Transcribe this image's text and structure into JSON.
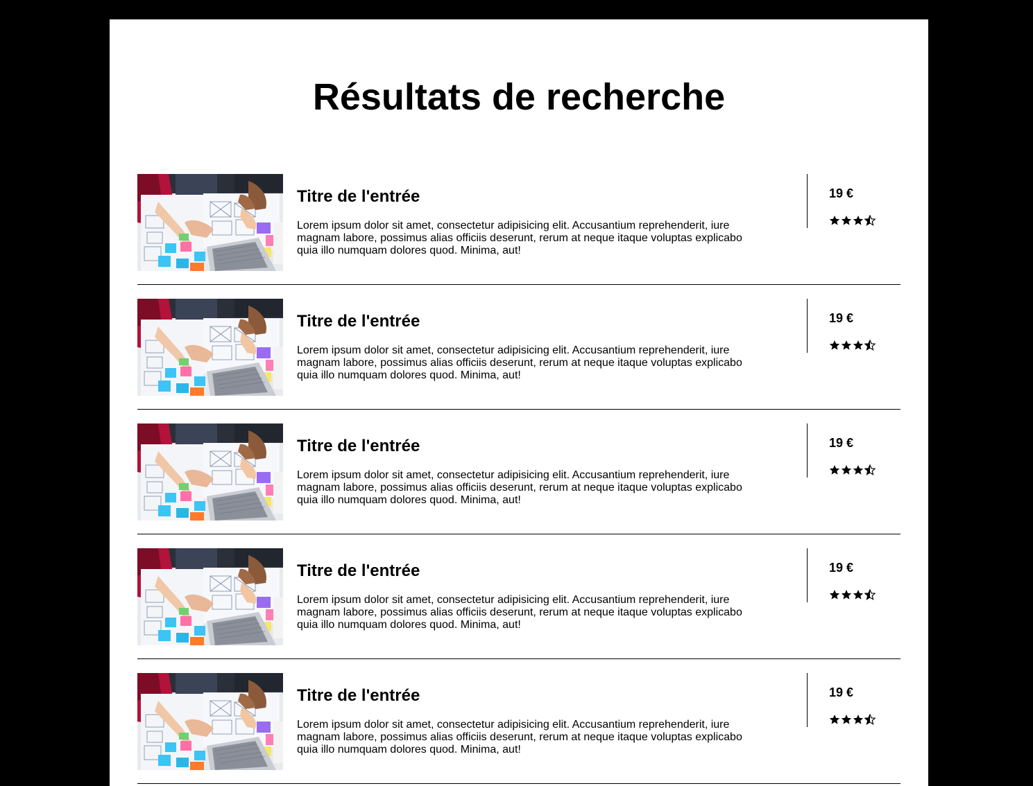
{
  "page": {
    "title": "Résultats de recherche"
  },
  "colors": {
    "background": "#000000",
    "panel": "#ffffff",
    "text": "#000000"
  },
  "results": [
    {
      "image_icon": "team-working-photo",
      "title": "Titre de l'entrée",
      "description": "Lorem ipsum dolor sit amet, consectetur adipisicing elit. Accusantium reprehenderit, iure magnam labore, possimus alias officiis deserunt, rerum at neque itaque voluptas explicabo quia illo numquam dolores quod. Minima, aut!",
      "price": "19 €",
      "rating": 3.5,
      "rating_max": 5
    },
    {
      "image_icon": "team-working-photo",
      "title": "Titre de l'entrée",
      "description": "Lorem ipsum dolor sit amet, consectetur adipisicing elit. Accusantium reprehenderit, iure magnam labore, possimus alias officiis deserunt, rerum at neque itaque voluptas explicabo quia illo numquam dolores quod. Minima, aut!",
      "price": "19 €",
      "rating": 3.5,
      "rating_max": 5
    },
    {
      "image_icon": "team-working-photo",
      "title": "Titre de l'entrée",
      "description": "Lorem ipsum dolor sit amet, consectetur adipisicing elit. Accusantium reprehenderit, iure magnam labore, possimus alias officiis deserunt, rerum at neque itaque voluptas explicabo quia illo numquam dolores quod. Minima, aut!",
      "price": "19 €",
      "rating": 3.5,
      "rating_max": 5
    },
    {
      "image_icon": "team-working-photo",
      "title": "Titre de l'entrée",
      "description": "Lorem ipsum dolor sit amet, consectetur adipisicing elit. Accusantium reprehenderit, iure magnam labore, possimus alias officiis deserunt, rerum at neque itaque voluptas explicabo quia illo numquam dolores quod. Minima, aut!",
      "price": "19 €",
      "rating": 3.5,
      "rating_max": 5
    },
    {
      "image_icon": "team-working-photo",
      "title": "Titre de l'entrée",
      "description": "Lorem ipsum dolor sit amet, consectetur adipisicing elit. Accusantium reprehenderit, iure magnam labore, possimus alias officiis deserunt, rerum at neque itaque voluptas explicabo quia illo numquam dolores quod. Minima, aut!",
      "price": "19 €",
      "rating": 3.5,
      "rating_max": 5
    }
  ]
}
